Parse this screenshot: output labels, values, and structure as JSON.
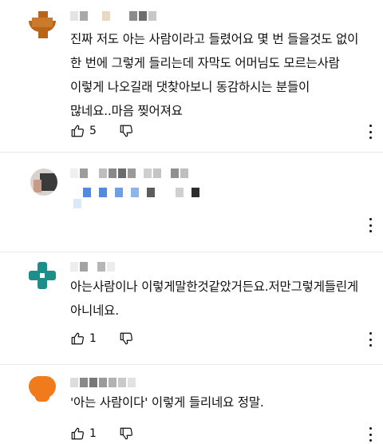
{
  "comments": [
    {
      "text": "진짜 저도 아는 사람이라고 들렸어요 몇 번 들을것도 없이\n한 번에 그렇게 들리는데 자막도 어머님도 모르는사람\n이렇게 나오길래 댓찾아보니 동감하시는 분들이\n많네요..마음 찢어져요",
      "likes": "5",
      "avatar_color": "#b8651a"
    },
    {
      "text": "",
      "likes": "",
      "avatar_color": "#3a3a3a"
    },
    {
      "text": "아는사람이나 이렇게말한것같았거든요.저만그렇게들린게\n아니네요.",
      "likes": "1",
      "avatar_color": "#1f8e8a"
    },
    {
      "text": "'아는 사람이다' 이렇게 들리네요 정말.",
      "likes": "1",
      "avatar_color": "#f07b1a"
    }
  ],
  "icons": {
    "like": "thumbs-up-icon",
    "dislike": "thumbs-down-icon",
    "more": "more-vertical-icon"
  },
  "colors": {
    "text": "#0f0f0f",
    "divider": "#e9e9e9",
    "censor_gray": "#8a8a8a",
    "censor_blue": "#4f8be0"
  }
}
